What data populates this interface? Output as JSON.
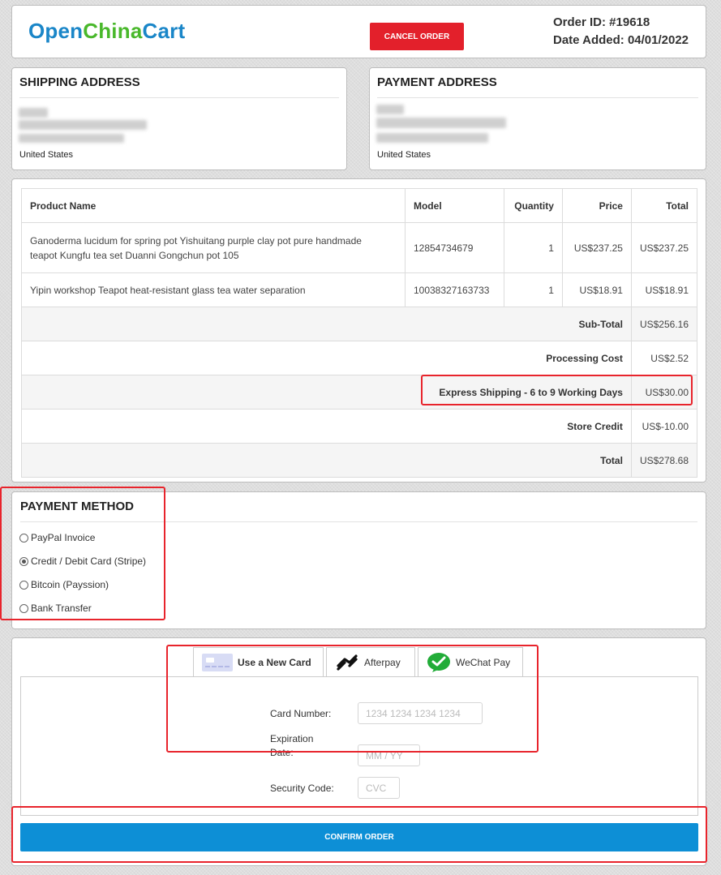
{
  "header": {
    "logo_part1": "Open",
    "logo_part2": "China",
    "logo_part3": "Cart",
    "cancel_label": "CANCEL ORDER",
    "order_id": "Order ID: #19618",
    "date_added": "Date Added: 04/01/2022"
  },
  "shipping_address": {
    "title": "SHIPPING ADDRESS",
    "country": "United States"
  },
  "payment_address": {
    "title": "PAYMENT ADDRESS",
    "country": "United States"
  },
  "table": {
    "headers": [
      "Product Name",
      "Model",
      "Quantity",
      "Price",
      "Total"
    ],
    "rows": [
      {
        "name_line1": "Ganoderma lucidum for spring pot Yishuitang purple clay pot pure handmade",
        "name_line2": "teapot Kungfu tea set Duanni Gongchun pot 105",
        "model": "12854734679",
        "quantity": "1",
        "price": "US$237.25",
        "total": "US$237.25"
      },
      {
        "name_line1": "Yipin workshop Teapot heat-resistant glass tea water separation",
        "model": "10038327163733",
        "quantity": "1",
        "price": "US$18.91",
        "total": "US$18.91"
      }
    ],
    "totals": [
      {
        "label": "Sub-Total",
        "value": "US$256.16"
      },
      {
        "label": "Processing Cost",
        "value": "US$2.52"
      },
      {
        "label": "Express Shipping - 6 to 9 Working Days",
        "value": "US$30.00"
      },
      {
        "label": "Store Credit",
        "value": "US$-10.00"
      },
      {
        "label": "Total",
        "value": "US$278.68"
      }
    ]
  },
  "payment_method": {
    "title": "PAYMENT METHOD",
    "options": [
      {
        "label": "PayPal Invoice",
        "selected": false
      },
      {
        "label": "Credit / Debit Card (Stripe)",
        "selected": true
      },
      {
        "label": "Bitcoin (Payssion)",
        "selected": false
      },
      {
        "label": "Bank Transfer",
        "selected": false
      }
    ]
  },
  "card": {
    "tabs": [
      {
        "label": "Use a New Card",
        "icon": "credit-card-icon"
      },
      {
        "label": "Afterpay",
        "icon": "afterpay-icon"
      },
      {
        "label": "WeChat Pay",
        "icon": "wechat-icon"
      }
    ],
    "card_number_label": "Card Number:",
    "card_number_placeholder": "1234 1234 1234 1234",
    "expiration_label_1": "Expiration",
    "expiration_label_2": "Date:",
    "expiration_placeholder": "MM / YY",
    "security_label": "Security Code:",
    "security_placeholder": "CVC",
    "confirm_label": "CONFIRM ORDER"
  },
  "colors": {
    "brand_blue": "#1a86c8",
    "brand_green": "#49b82b",
    "cancel_red": "#e3202b",
    "confirm_blue": "#0d8fd6",
    "highlight_red": "#e8242c"
  }
}
